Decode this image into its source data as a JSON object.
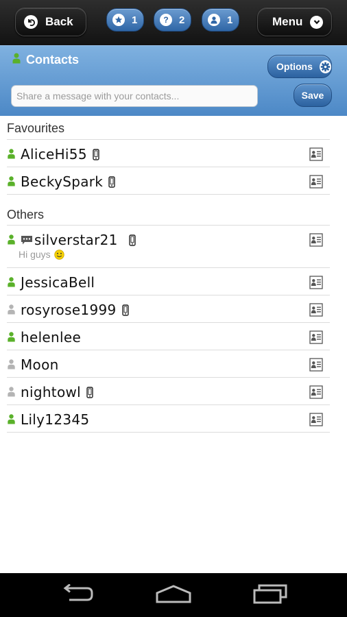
{
  "toolbar": {
    "back_label": "Back",
    "menu_label": "Menu",
    "favourites_count": "1",
    "help_count": "2",
    "contacts_count": "1"
  },
  "header": {
    "title": "Contacts",
    "options_label": "Options",
    "message_placeholder": "Share a message with your contacts...",
    "message_value": "",
    "save_label": "Save"
  },
  "favourites": {
    "title": "Favourites",
    "contacts": [
      {
        "name": "AliceHi55",
        "online": true,
        "mobile": true
      },
      {
        "name": "BeckySpark",
        "online": true,
        "mobile": true
      }
    ]
  },
  "others": {
    "title": "Others",
    "contacts": [
      {
        "name": "silverstar21",
        "online": true,
        "mobile": true,
        "has_message": true,
        "status_text": "Hi guys"
      },
      {
        "name": "JessicaBell",
        "online": true,
        "mobile": false
      },
      {
        "name": "rosyrose1999",
        "online": false,
        "mobile": true
      },
      {
        "name": "helenlee",
        "online": true,
        "mobile": false
      },
      {
        "name": "Moon",
        "online": false,
        "mobile": false
      },
      {
        "name": "nightowl",
        "online": false,
        "mobile": true
      },
      {
        "name": "Lily12345",
        "online": true,
        "mobile": false
      }
    ]
  },
  "colors": {
    "online": "#5ab12a",
    "offline": "#b4b4b4",
    "header_blue": "#4c88c6",
    "toolbar_dark": "#1c1c1c"
  },
  "icons": {
    "back": "back-arrow-icon",
    "menu": "chevron-down-icon",
    "favourites": "star-icon",
    "help": "question-icon",
    "contacts": "person-icon",
    "options": "gear-icon",
    "contact_card": "contact-card-icon",
    "mobile": "mobile-phone-icon",
    "presence": "person-icon",
    "message": "speech-bubble-icon",
    "smiley": "smiley-icon",
    "nav_back": "nav-back-icon",
    "nav_home": "nav-home-icon",
    "nav_recents": "nav-recents-icon"
  }
}
